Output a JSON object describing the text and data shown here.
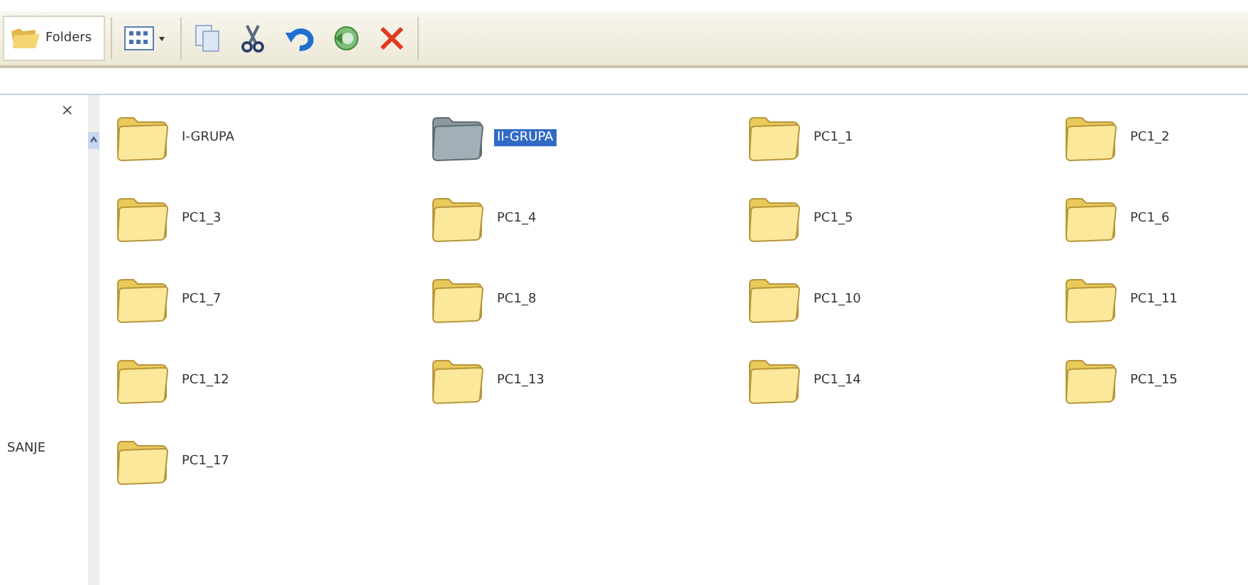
{
  "toolbar": {
    "folders_button": {
      "label": "Folders",
      "selected": true
    }
  },
  "left_pane": {
    "close": "×",
    "items": [
      "SANJE"
    ]
  },
  "folders": [
    {
      "name": "I-GRUPA",
      "selected": false
    },
    {
      "name": "II-GRUPA",
      "selected": true
    },
    {
      "name": "PC1_1",
      "selected": false
    },
    {
      "name": "PC1_2",
      "selected": false
    },
    {
      "name": "PC1_3",
      "selected": false
    },
    {
      "name": "PC1_4",
      "selected": false
    },
    {
      "name": "PC1_5",
      "selected": false
    },
    {
      "name": "PC1_6",
      "selected": false
    },
    {
      "name": "PC1_7",
      "selected": false
    },
    {
      "name": "PC1_8",
      "selected": false
    },
    {
      "name": "PC1_10",
      "selected": false
    },
    {
      "name": "PC1_11",
      "selected": false
    },
    {
      "name": "PC1_12",
      "selected": false
    },
    {
      "name": "PC1_13",
      "selected": false
    },
    {
      "name": "PC1_14",
      "selected": false
    },
    {
      "name": "PC1_15",
      "selected": false
    },
    {
      "name": "PC1_17",
      "selected": false
    }
  ]
}
